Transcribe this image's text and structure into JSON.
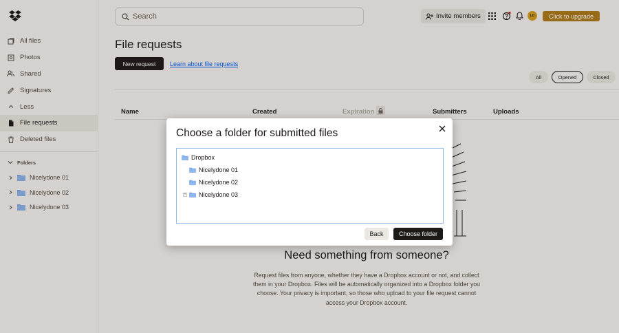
{
  "sidebar": {
    "items": [
      {
        "label": "All files",
        "icon": "all-files-icon"
      },
      {
        "label": "Photos",
        "icon": "photos-icon"
      },
      {
        "label": "Shared",
        "icon": "shared-icon"
      },
      {
        "label": "Signatures",
        "icon": "signatures-icon"
      },
      {
        "label": "Less",
        "icon": "chevron-up-icon"
      },
      {
        "label": "File requests",
        "icon": "file-requests-icon",
        "active": true
      },
      {
        "label": "Deleted files",
        "icon": "trash-icon"
      }
    ],
    "folders_label": "Folders",
    "folders": [
      {
        "label": "Nicelydone 01"
      },
      {
        "label": "Nicelydone 02"
      },
      {
        "label": "Nicelydone 03"
      }
    ]
  },
  "topbar": {
    "search_placeholder": "Search",
    "invite_label": "Invite members",
    "avatar_initials": "LD",
    "upgrade_label": "Click to upgrade"
  },
  "main": {
    "title": "File requests",
    "new_request_label": "New request",
    "learn_link": "Learn about file requests",
    "filters": [
      "All",
      "Opened",
      "Closed"
    ],
    "selected_filter": "Opened",
    "columns": [
      "Name",
      "Created",
      "Expiration",
      "Submitters",
      "Uploads"
    ],
    "empty_title": "Need something from someone?",
    "empty_body": "Request files from anyone, whether they have a Dropbox account or not, and collect them in your Dropbox. Files will be automatically organized into a Dropbox folder you choose. Your privacy is important, so those who upload to your file request cannot access your Dropbox account."
  },
  "modal": {
    "title": "Choose a folder for submitted files",
    "tree": {
      "root": "Dropbox",
      "children": [
        "Nicelydone 01",
        "Nicelydone 02",
        "Nicelydone 03"
      ]
    },
    "back_label": "Back",
    "choose_label": "Choose folder"
  },
  "colors": {
    "accent_link": "#0061fe",
    "upgrade": "#b07b1a",
    "folder": "#7aa7e8",
    "dark": "#1e1919"
  }
}
